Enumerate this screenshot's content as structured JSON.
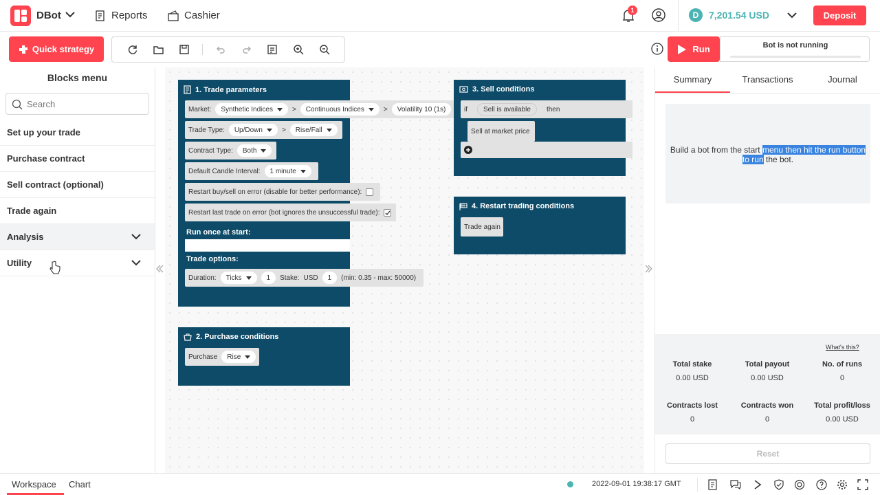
{
  "header": {
    "brand": "DBot",
    "nav": [
      {
        "label": "Reports"
      },
      {
        "label": "Cashier"
      }
    ],
    "notification_count": "1",
    "balance": "7,201.54 USD",
    "deposit_label": "Deposit"
  },
  "toolbar": {
    "quick_strategy_label": "Quick strategy",
    "run_label": "Run",
    "status_text": "Bot is not running"
  },
  "sidebar": {
    "title": "Blocks menu",
    "search_placeholder": "Search",
    "items": [
      {
        "label": "Set up your trade"
      },
      {
        "label": "Purchase contract"
      },
      {
        "label": "Sell contract (optional)"
      },
      {
        "label": "Trade again"
      },
      {
        "label": "Analysis"
      },
      {
        "label": "Utility"
      }
    ]
  },
  "blocks": {
    "trade_parameters": {
      "title": "1. Trade parameters",
      "market_label": "Market:",
      "market": [
        "Synthetic Indices",
        "Continuous Indices",
        "Volatility 10 (1s)"
      ],
      "trade_type_label": "Trade Type:",
      "trade_type": [
        "Up/Down",
        "Rise/Fall"
      ],
      "contract_type_label": "Contract Type:",
      "contract_type": "Both",
      "candle_label": "Default Candle Interval:",
      "candle": "1 minute",
      "restart_buy_sell": "Restart buy/sell on error (disable for better performance):",
      "restart_last": "Restart last trade on error (bot ignores the unsuccessful trade):",
      "run_once": "Run once at start:",
      "trade_options": "Trade options:",
      "duration_label": "Duration:",
      "duration_unit": "Ticks",
      "duration_value": "1",
      "stake_label": "Stake:",
      "stake_currency": "USD",
      "stake_value": "1",
      "stake_range": "(min: 0.35 - max: 50000)"
    },
    "purchase_conditions": {
      "title": "2. Purchase conditions",
      "purchase_label": "Purchase",
      "purchase_value": "Rise"
    },
    "sell_conditions": {
      "title": "3. Sell conditions",
      "if_label": "if",
      "condition": "Sell is available",
      "then_label": "then",
      "action": "Sell at market price"
    },
    "restart_trading": {
      "title": "4. Restart trading conditions",
      "action": "Trade again"
    }
  },
  "right_panel": {
    "tabs": [
      {
        "label": "Summary"
      },
      {
        "label": "Transactions"
      },
      {
        "label": "Journal"
      }
    ],
    "summary_text": {
      "part1": "Build a bot from the start ",
      "highlighted": "menu then hit the run button to run",
      "part2": " the bot."
    },
    "whats_this": "What's this?",
    "stats": [
      {
        "label": "Total stake",
        "value": "0.00 USD"
      },
      {
        "label": "Total payout",
        "value": "0.00 USD"
      },
      {
        "label": "No. of runs",
        "value": "0"
      },
      {
        "label": "Contracts lost",
        "value": "0"
      },
      {
        "label": "Contracts won",
        "value": "0"
      },
      {
        "label": "Total profit/loss",
        "value": "0.00 USD"
      }
    ],
    "reset_label": "Reset"
  },
  "footer": {
    "tabs": [
      {
        "label": "Workspace"
      },
      {
        "label": "Chart"
      }
    ],
    "timestamp": "2022-09-01 19:38:17 GMT",
    "status_color": "#4bb4b3"
  },
  "colors": {
    "accent": "#ff444f",
    "block": "#0e4b68",
    "balance": "#4bb4b3"
  }
}
